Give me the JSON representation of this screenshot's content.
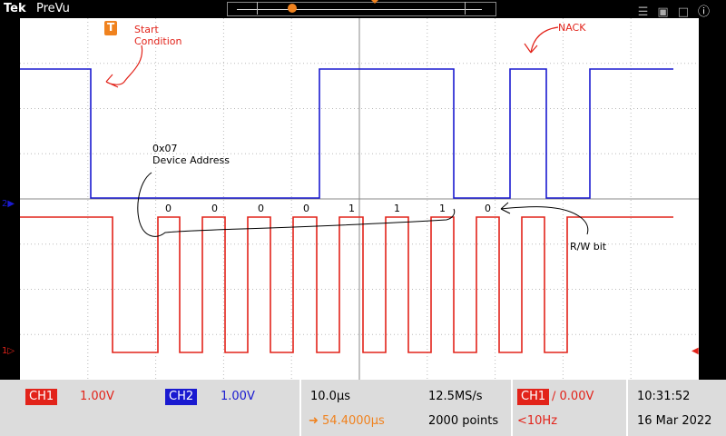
{
  "header": {
    "brand": "Tek",
    "mode": "PreVu"
  },
  "annotations": {
    "start_line1": "Start",
    "start_line2": "Condition",
    "nack": "NACK",
    "addr_line1": "0x07",
    "addr_line2": "Device Address",
    "rw": "R/W bit",
    "bits": [
      "0",
      "0",
      "0",
      "0",
      "1",
      "1",
      "1",
      "0"
    ]
  },
  "markers": {
    "trigger": "T",
    "ch2": "2",
    "ch1": "1"
  },
  "status": {
    "ch1_label": "CH1",
    "ch1_scale": "1.00V",
    "ch2_label": "CH2",
    "ch2_scale": "1.00V",
    "timebase": "10.0µs",
    "sample_rate": "12.5MS/s",
    "position": "54.4000µs",
    "points": "2000 points",
    "trig_source": "CH1",
    "trig_level": "0.00V",
    "trig_freq": "<10Hz",
    "time": "10:31:52",
    "date": "16 Mar 2022"
  },
  "colors": {
    "ch1": "#e2231a",
    "ch2": "#1a1ad0",
    "trigger": "#f0821e"
  },
  "icons": [
    "wifi-icon",
    "network-icon",
    "window-icon",
    "help-icon"
  ]
}
